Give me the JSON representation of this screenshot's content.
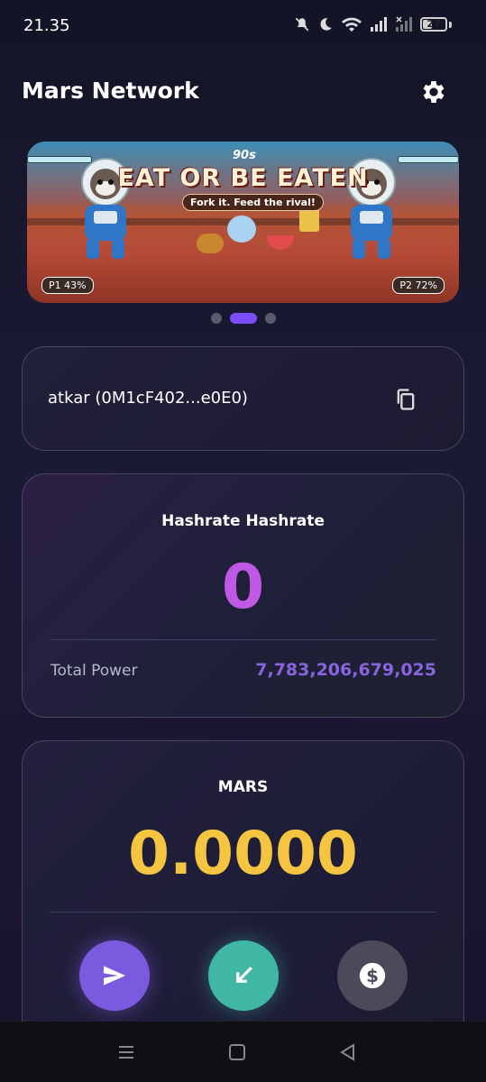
{
  "status_bar": {
    "time": "21.35",
    "battery": "27",
    "icons": [
      "mute-icon",
      "moon-icon",
      "wifi-icon",
      "signal-icon",
      "signal-x-icon",
      "battery-icon"
    ]
  },
  "header": {
    "title": "Mars Network",
    "settings_icon": "gear-icon"
  },
  "banner": {
    "title": "EAT OR BE EATEN",
    "badge": "90s",
    "subtitle": "Fork it. Feed the rival!",
    "p1": "P1 43%",
    "p2": "P2 72%",
    "carousel_count": 3,
    "carousel_active": 1
  },
  "wallet": {
    "address_text": "atkar (0M1cF402...e0E0)",
    "copy_icon": "copy-icon"
  },
  "hashrate": {
    "label": "Hashrate Hashrate",
    "value": "0",
    "total_label": "Total Power",
    "total_value": "7,783,206,679,025"
  },
  "mars": {
    "label": "MARS",
    "value": "0.0000",
    "actions": [
      "send-icon",
      "receive-icon",
      "dollar-icon"
    ]
  },
  "colors": {
    "accent_purple": "#7c4dff",
    "hash_value": "#c05ae6",
    "total_value": "#8a63e0",
    "mars_value": "#f5c542",
    "receive": "#3fb7a4"
  }
}
